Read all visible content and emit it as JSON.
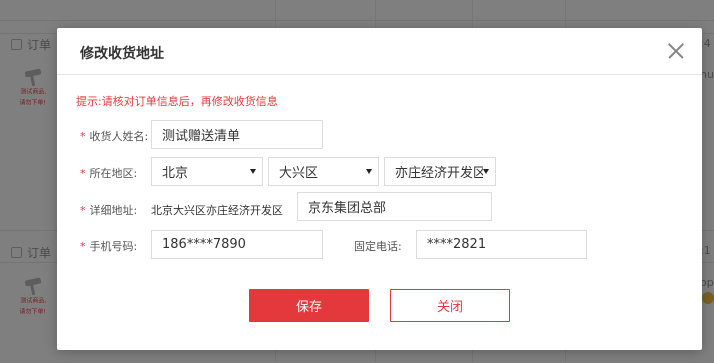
{
  "background": {
    "order_label": "订单",
    "thumb_text_line1": "测试商品,",
    "thumb_text_line2": "请勿下单!",
    "right_fragment_1": ":4",
    "right_fragment_2": "hu",
    "right_fragment_3": ":1",
    "right_fragment_4": "op"
  },
  "modal": {
    "title": "修改收货地址",
    "tip": "提示:请核对订单信息后，再修改收货信息",
    "recipient": {
      "label": "收货人姓名:",
      "value": "测试赠送清单"
    },
    "region": {
      "label": "所在地区:",
      "province": "北京",
      "district": "大兴区",
      "area": "亦庄经济开发区"
    },
    "address": {
      "label": "详细地址:",
      "prefix": "北京大兴区亦庄经济开发区",
      "value": "京东集团总部"
    },
    "mobile": {
      "label": "手机号码:",
      "value": "186****7890"
    },
    "landline": {
      "label": "固定电话:",
      "value": "****2821"
    },
    "save_label": "保存",
    "close_label": "关闭"
  },
  "colors": {
    "accent": "#e4393c",
    "overlay": "rgba(0,0,0,0.5)"
  },
  "icons": {
    "close": "close-icon",
    "dropdown": "triangle-down-icon"
  }
}
